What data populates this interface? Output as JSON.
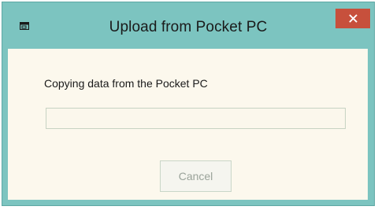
{
  "window": {
    "title": "Upload from Pocket PC",
    "close_glyph": "✕",
    "app_icon": "window-app-icon"
  },
  "dialog": {
    "status_text": "Copying data from the Pocket PC",
    "progress_fraction": 0,
    "cancel_label": "Cancel",
    "cancel_enabled": false
  },
  "colors": {
    "frame": "#7cc4c0",
    "close_button": "#c7503c",
    "client_background": "#fcf8ed"
  }
}
